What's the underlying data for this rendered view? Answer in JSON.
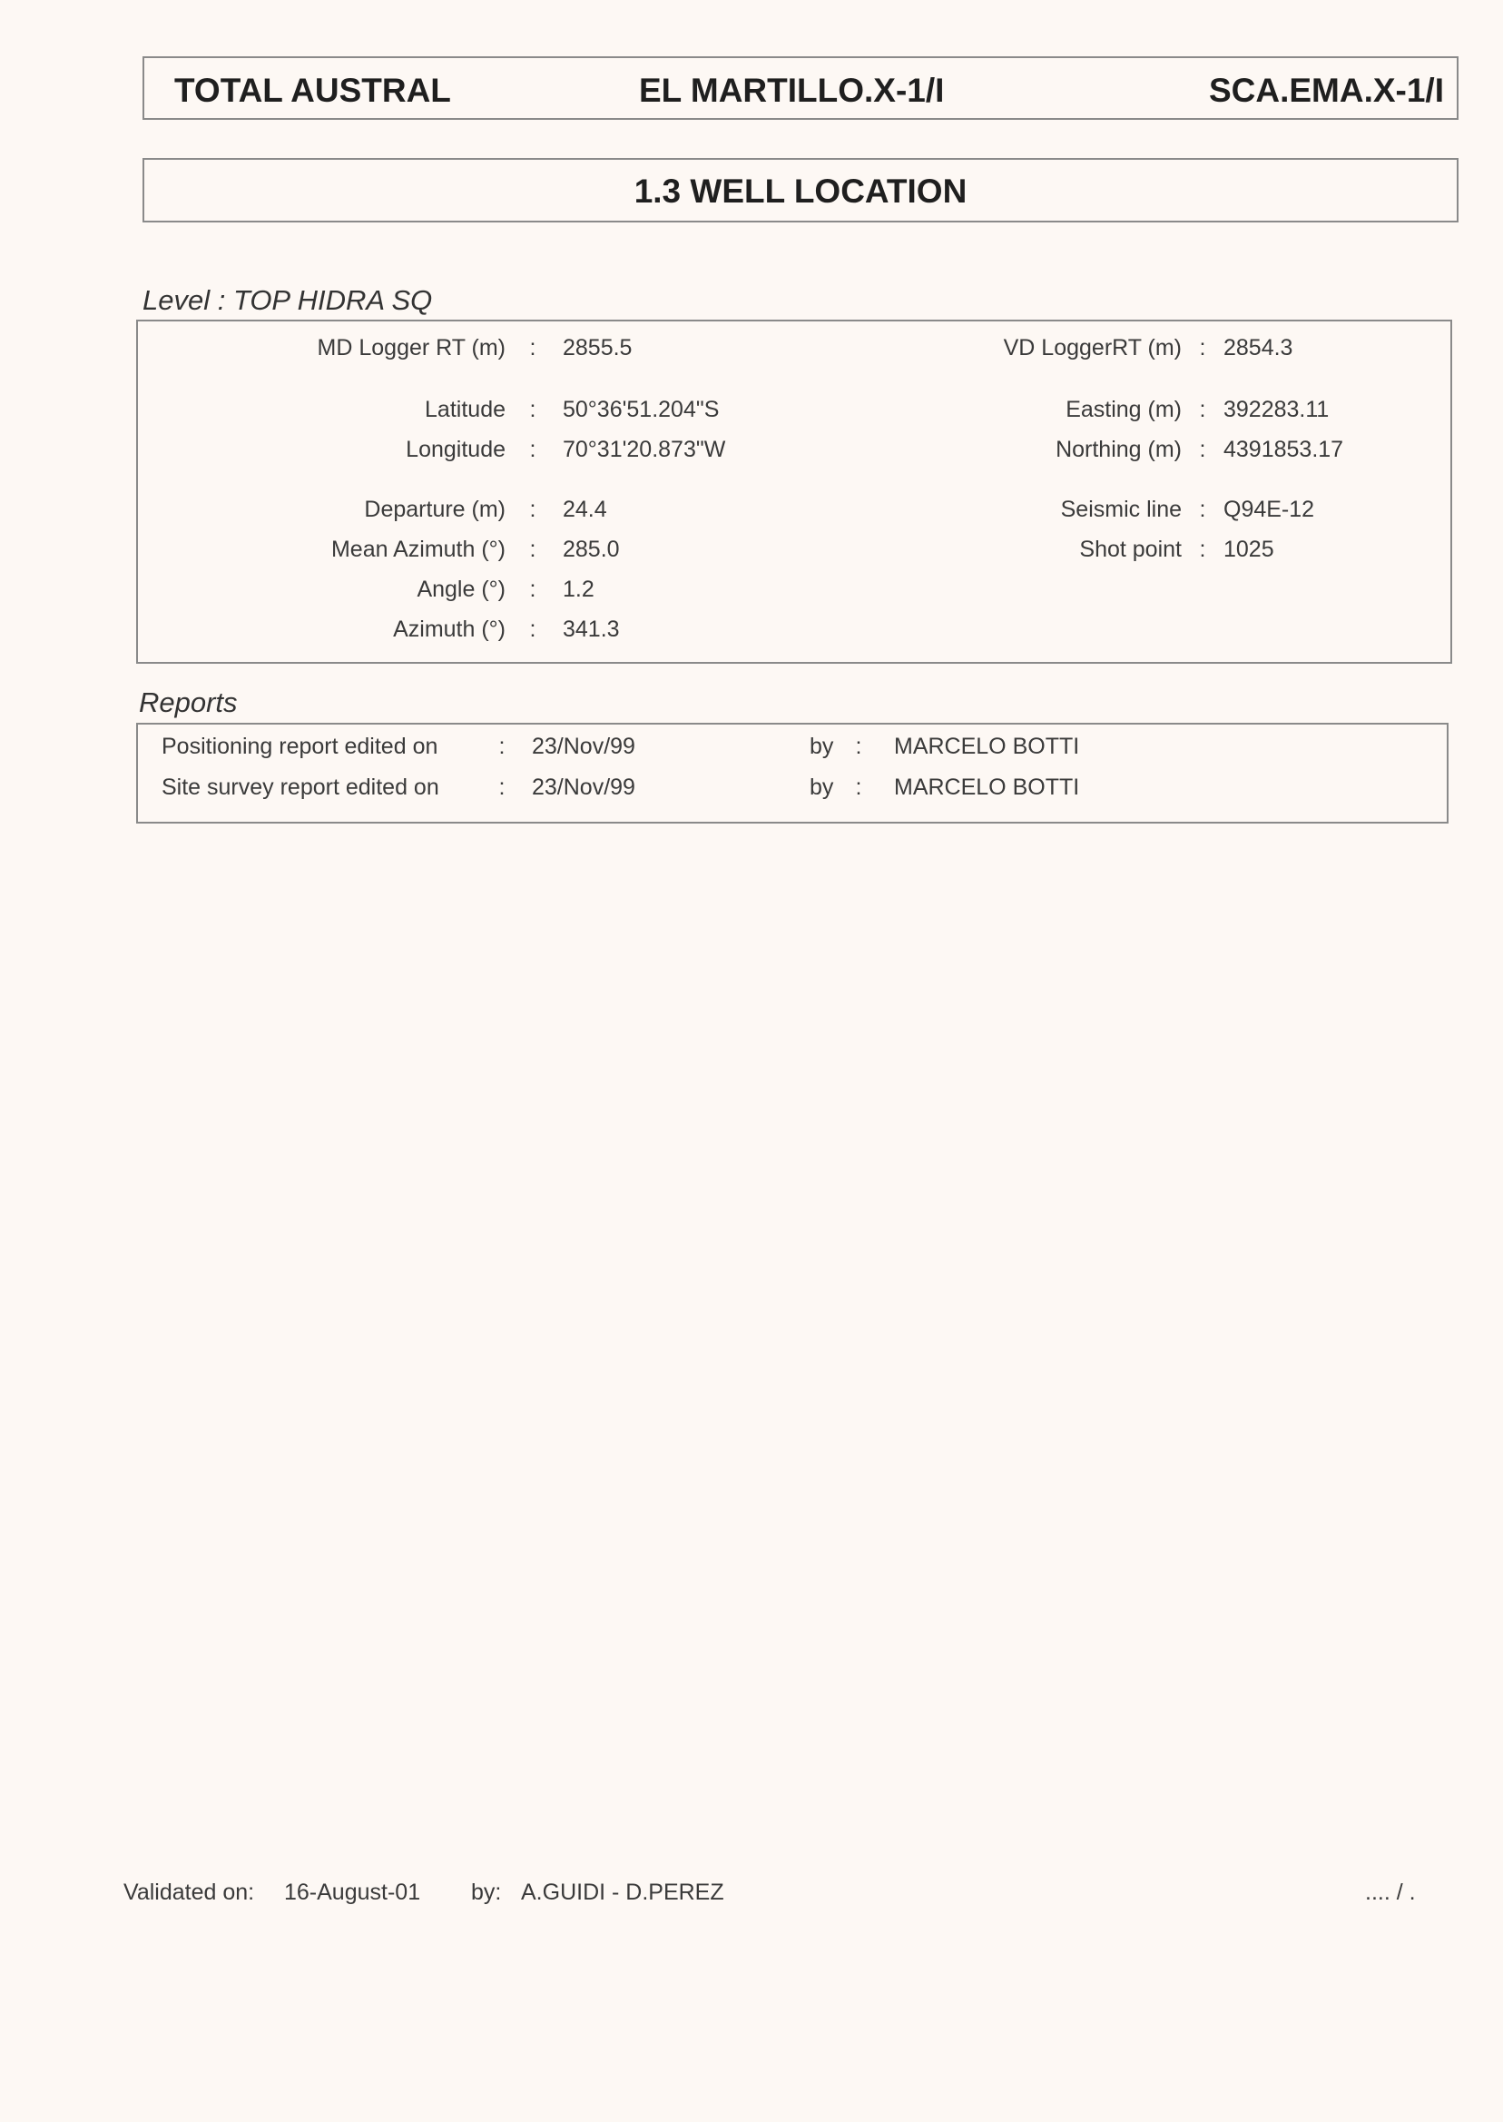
{
  "header": {
    "company": "TOTAL AUSTRAL",
    "well_name": "EL MARTILLO.X-1/I",
    "well_code": "SCA.EMA.X-1/I"
  },
  "section": {
    "title": "1.3  WELL LOCATION"
  },
  "level": {
    "label": "Level : TOP HIDRA SQ",
    "separator": ":",
    "fields": {
      "md_logger_rt": {
        "label": "MD Logger RT (m)",
        "value": "2855.5"
      },
      "vd_logger_rt": {
        "label": "VD LoggerRT (m)",
        "value": "2854.3"
      },
      "latitude": {
        "label": "Latitude",
        "value": "50°36'51.204\"S"
      },
      "easting": {
        "label": "Easting (m)",
        "value": "392283.11"
      },
      "longitude": {
        "label": "Longitude",
        "value": "70°31'20.873\"W"
      },
      "northing": {
        "label": "Northing (m)",
        "value": "4391853.17"
      },
      "departure": {
        "label": "Departure (m)",
        "value": "24.4"
      },
      "seismic_line": {
        "label": "Seismic line",
        "value": "Q94E-12"
      },
      "mean_azimuth": {
        "label": "Mean Azimuth (°)",
        "value": "285.0"
      },
      "shot_point": {
        "label": "Shot point",
        "value": "1025"
      },
      "angle": {
        "label": "Angle (°)",
        "value": "1.2"
      },
      "azimuth": {
        "label": "Azimuth (°)",
        "value": "341.3"
      }
    }
  },
  "reports": {
    "label": "Reports",
    "separator": ":",
    "by_label": "by",
    "items": [
      {
        "label": "Positioning report edited on",
        "date": "23/Nov/99",
        "author": "MARCELO BOTTI"
      },
      {
        "label": "Site survey report edited on",
        "date": "23/Nov/99",
        "author": "MARCELO BOTTI"
      }
    ]
  },
  "footer": {
    "validated_label": "Validated on:",
    "validated_date": "16-August-01",
    "by_label": "by:",
    "validators": "A.GUIDI - D.PEREZ",
    "continuation": ".... / ."
  }
}
